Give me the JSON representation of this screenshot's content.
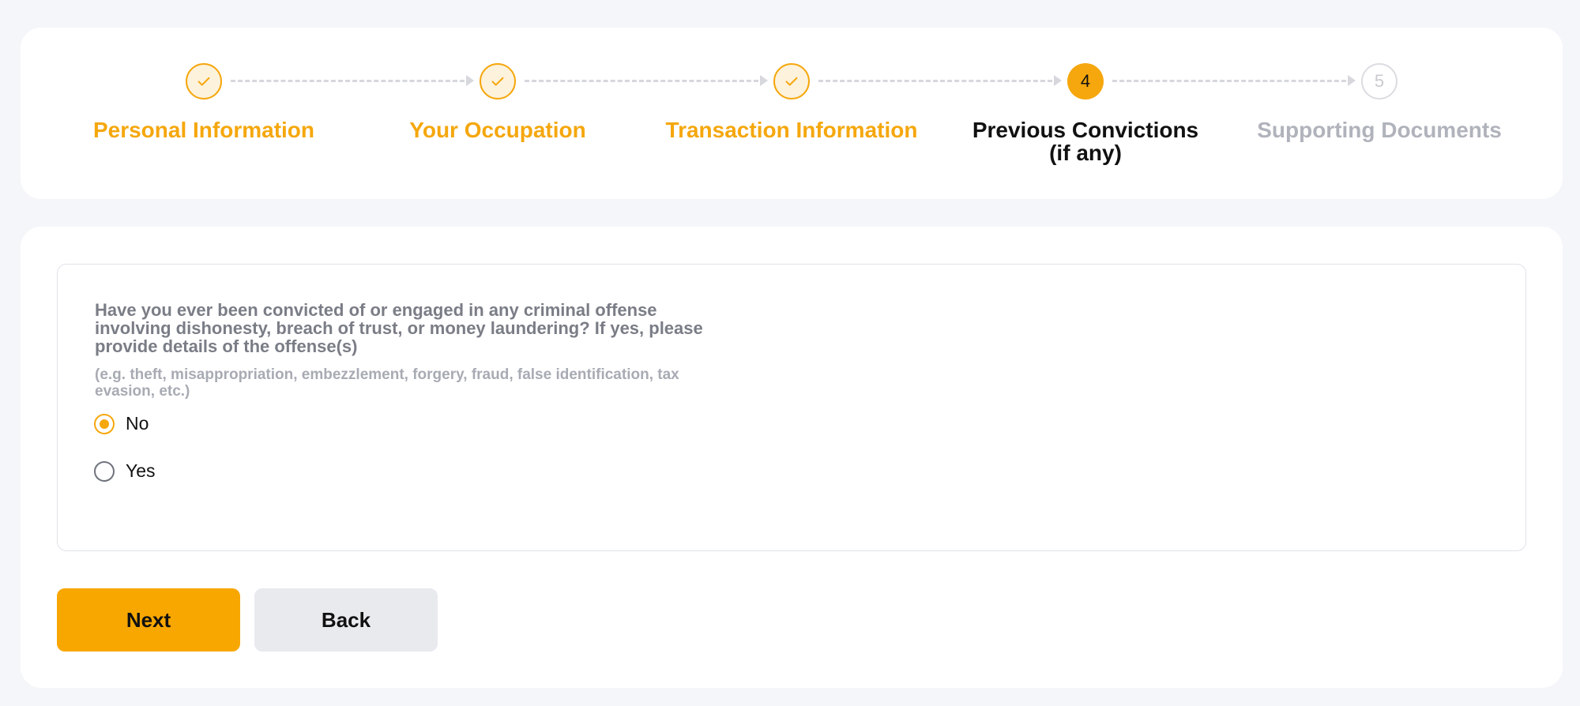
{
  "stepper": {
    "steps": [
      {
        "number": "1",
        "label_line1": "Personal Information",
        "label_line2": "",
        "status": "done"
      },
      {
        "number": "2",
        "label_line1": "Your Occupation",
        "label_line2": "",
        "status": "done"
      },
      {
        "number": "3",
        "label_line1": "Transaction Information",
        "label_line2": "",
        "status": "done"
      },
      {
        "number": "4",
        "label_line1": "Previous Convictions",
        "label_line2": "(if any)",
        "status": "active"
      },
      {
        "number": "5",
        "label_line1": "Supporting Documents",
        "label_line2": "",
        "status": "pending"
      }
    ]
  },
  "form": {
    "question": "Have you ever been convicted of or engaged in any criminal offense involving dishonesty, breach of trust, or money laundering? If yes, please provide details of the offense(s)",
    "hint": "(e.g. theft, misappropriation, embezzlement, forgery, fraud, false identification, tax evasion, etc.)",
    "options": [
      {
        "label": "No",
        "selected": true
      },
      {
        "label": "Yes",
        "selected": false
      }
    ]
  },
  "actions": {
    "next_label": "Next",
    "back_label": "Back"
  },
  "colors": {
    "accent": "#f5a70d",
    "page_background": "#f5f6f9",
    "pending": "#b0b3bb"
  }
}
